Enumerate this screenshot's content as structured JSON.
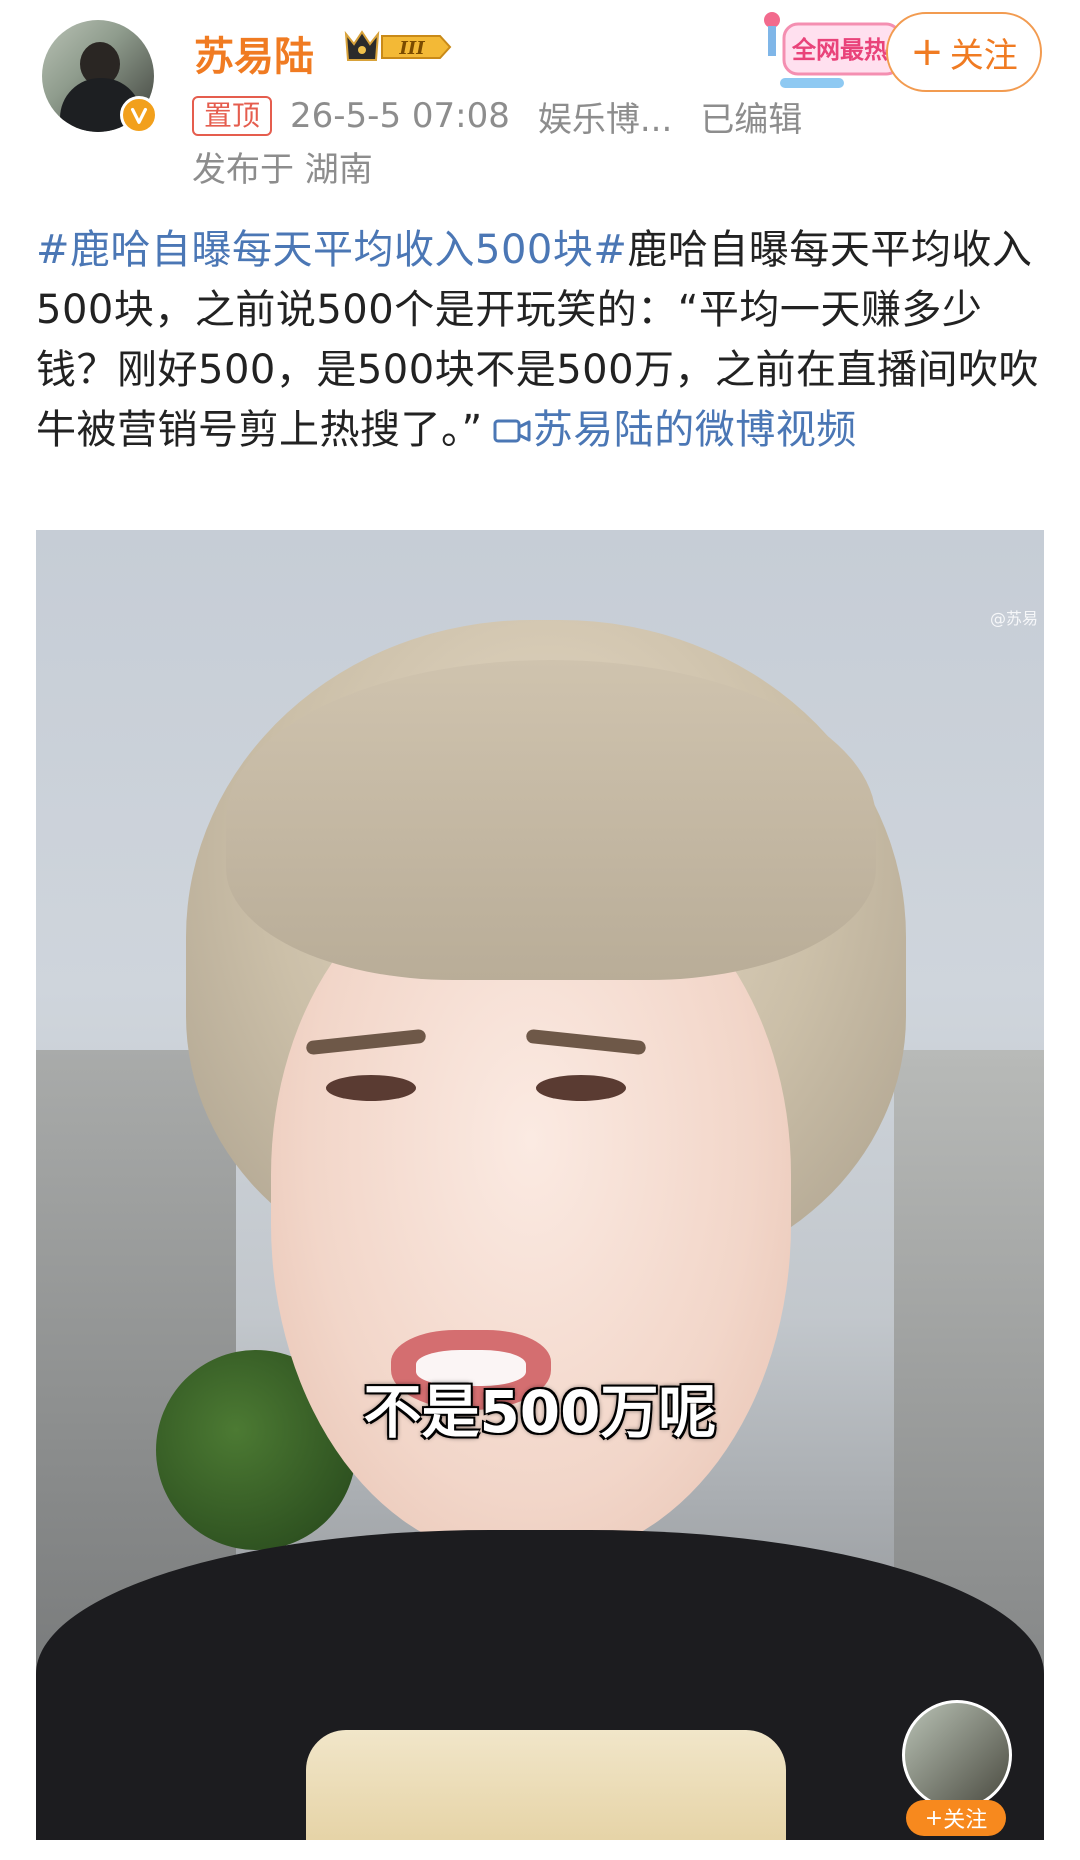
{
  "header": {
    "username": "苏易陆",
    "vip_level": "III",
    "pin_label": "置顶",
    "timestamp": "26-5-5 07:08",
    "source": "娱乐博...",
    "edited": "已编辑",
    "location": "发布于 湖南",
    "hot_sticker": "全网最热",
    "follow_label": "关注"
  },
  "post": {
    "topic": "#鹿哈自曝每天平均收入500块#",
    "text": "鹿哈自曝每天平均收入500块，之前说500个是开玩笑的：“平均一天赚多少钱？刚好500，是500块不是500万，之前在直播间吹吹牛被营销号剪上热搜了。”",
    "video_link": "苏易陆的微博视频"
  },
  "video": {
    "subtitle": "不是500万呢",
    "watermark": "@苏易",
    "mini_follow_label": "关注"
  },
  "colors": {
    "username": "#f07b22",
    "link": "#4b77b5",
    "pin": "#e55d4e"
  }
}
